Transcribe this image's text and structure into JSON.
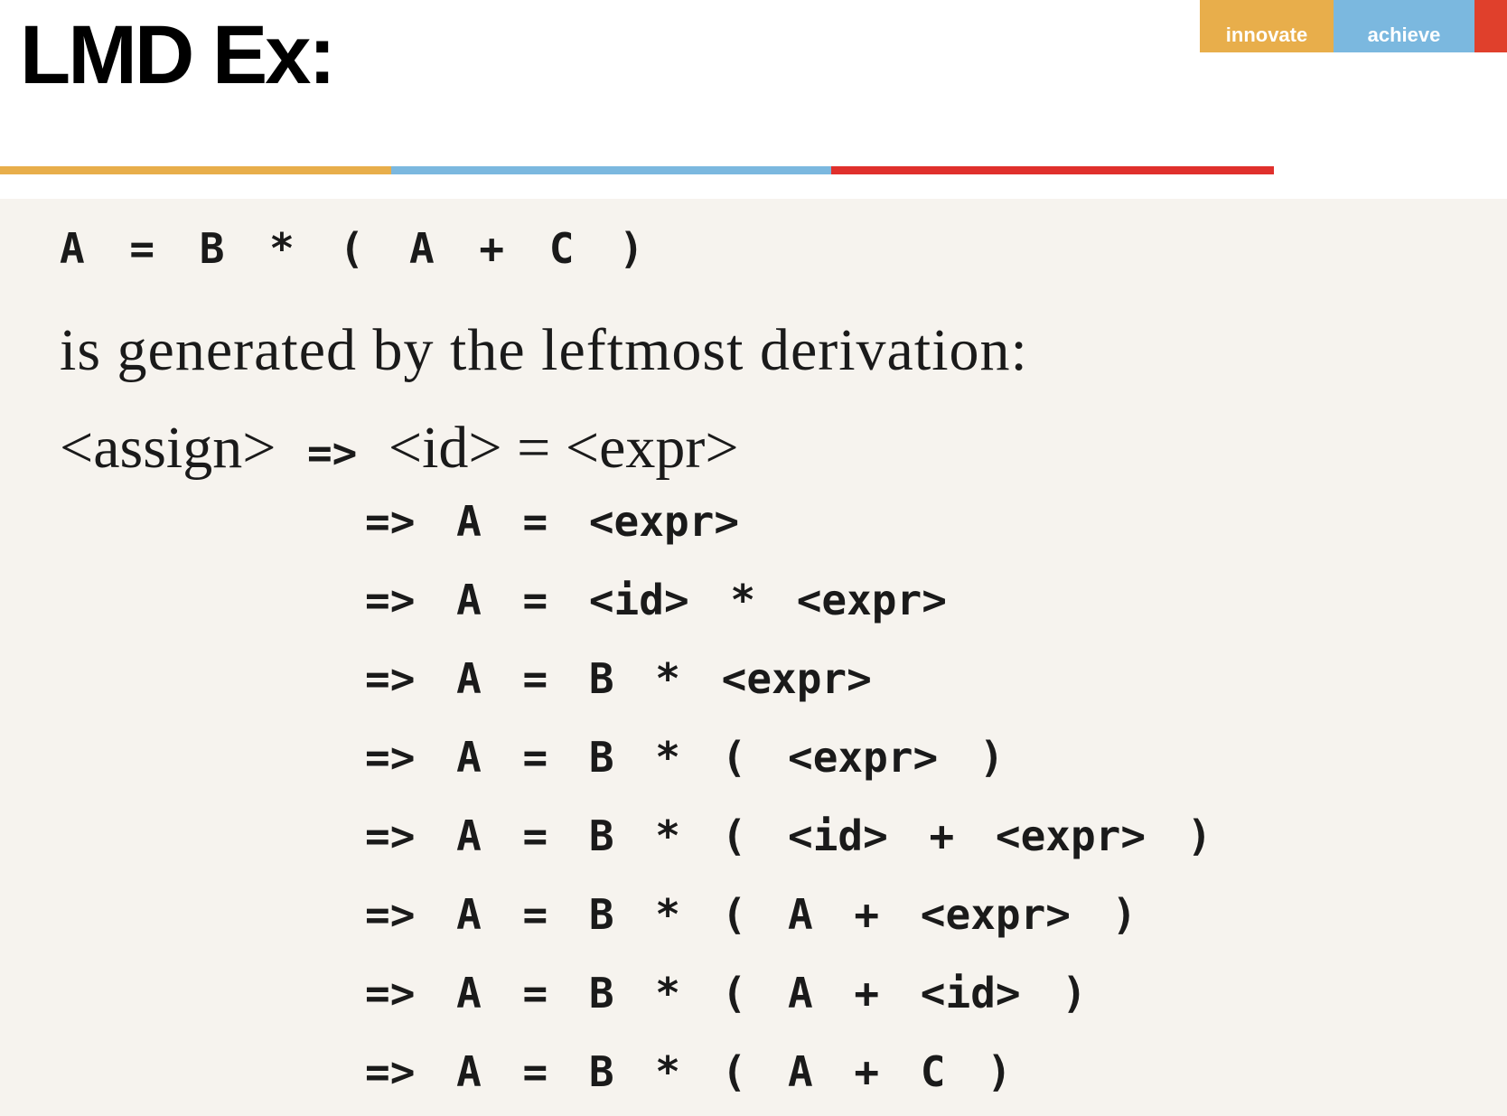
{
  "slide": {
    "title": "LMD Ex:"
  },
  "brand": {
    "innovate": "innovate",
    "achieve": "achieve"
  },
  "content": {
    "statement": "A = B * ( A + C )",
    "intro": "is generated by the leftmost derivation:",
    "first_step": {
      "lhs": "<assign>",
      "arrow": "=>",
      "rhs": "<id> = <expr>"
    },
    "steps": [
      "=> A = <expr>",
      "=> A = <id> * <expr>",
      "=> A = B * <expr>",
      "=> A = B * ( <expr> )",
      "=> A = B * ( <id> + <expr> )",
      "=> A = B * ( A + <expr> )",
      "=> A = B * ( A + <id> )",
      "=> A = B * ( A + C )"
    ]
  }
}
